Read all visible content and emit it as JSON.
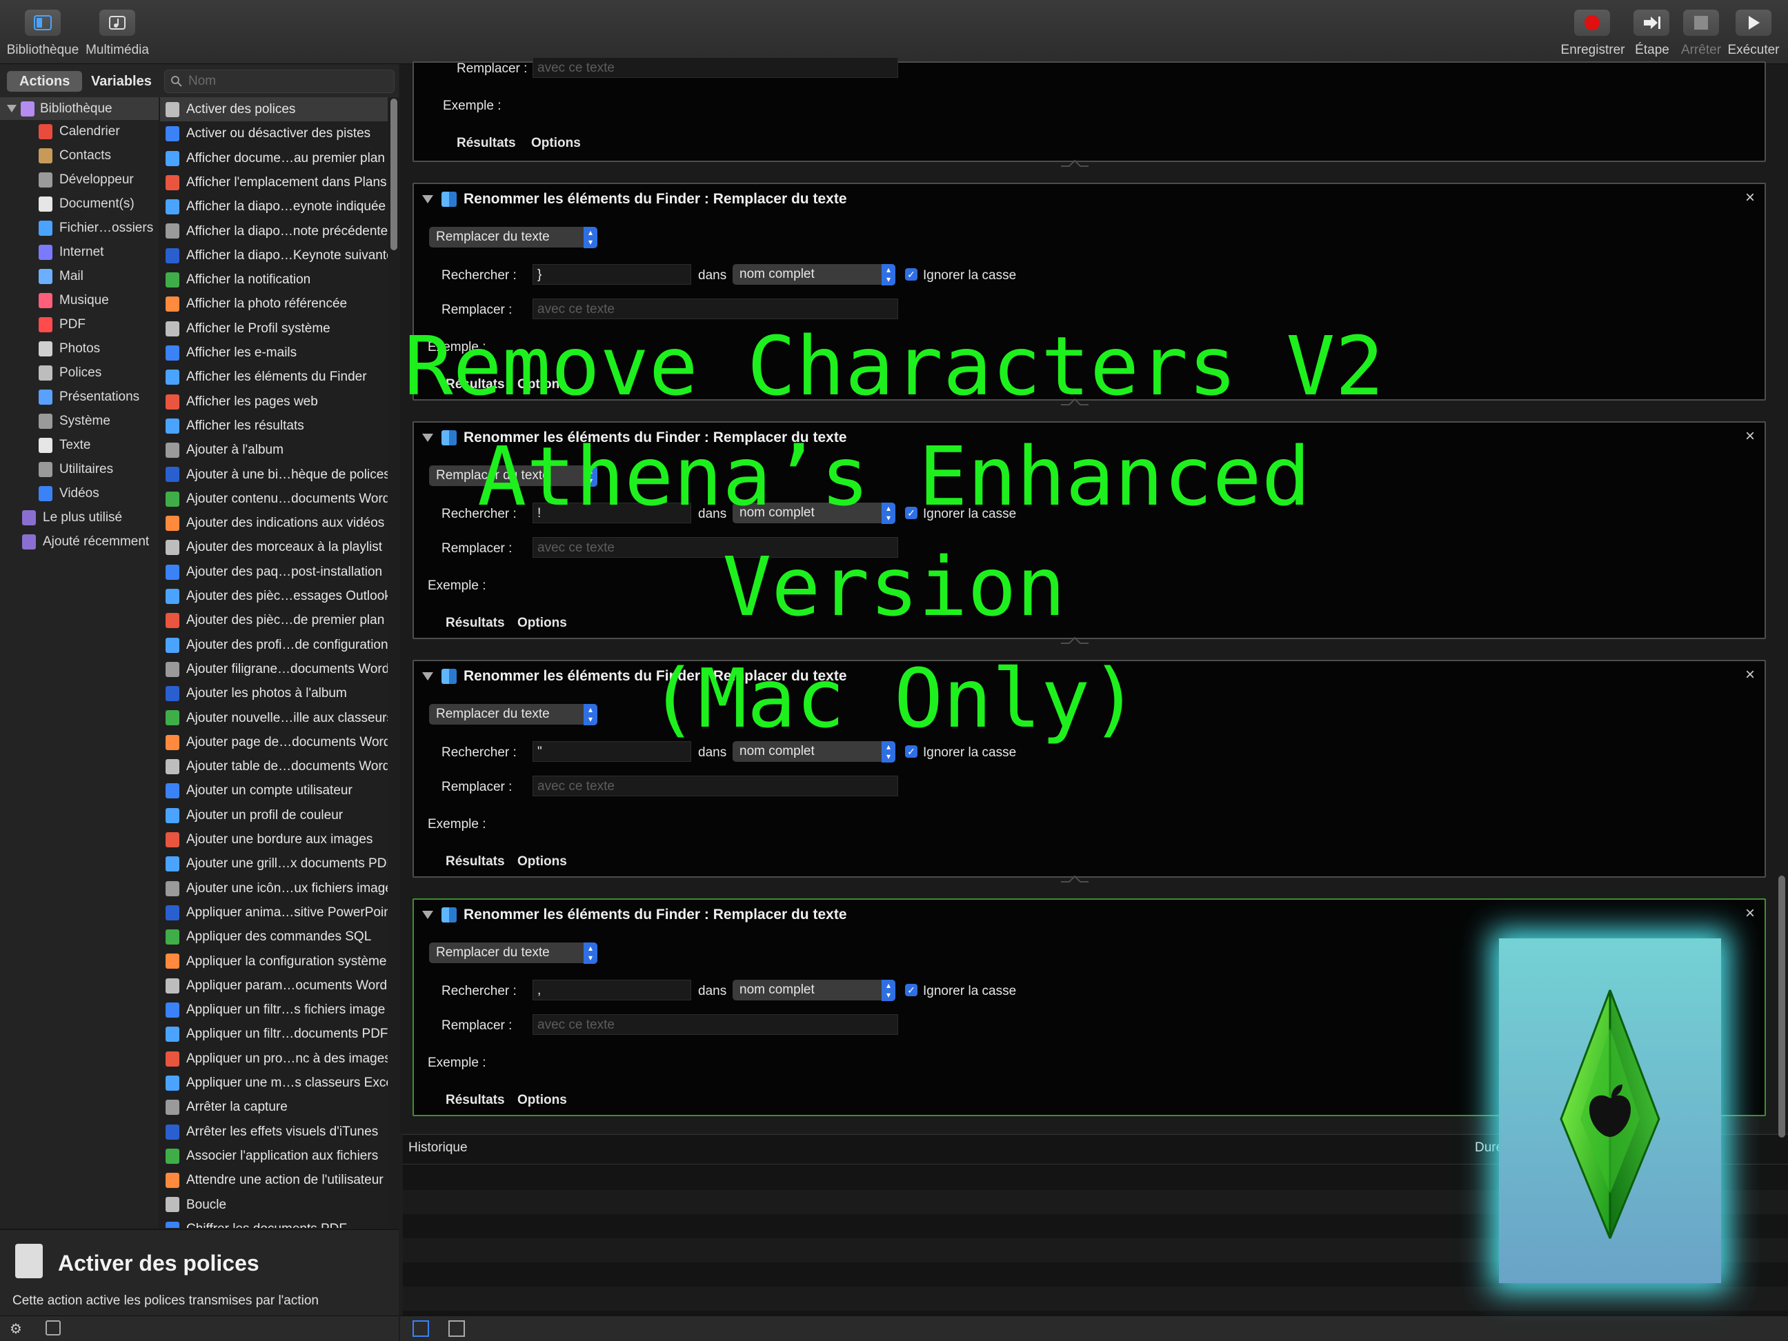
{
  "toolbar": {
    "library_label": "Bibliothèque",
    "media_label": "Multimédia",
    "record_label": "Enregistrer",
    "step_label": "Étape",
    "stop_label": "Arrêter",
    "run_label": "Exécuter"
  },
  "tabs": {
    "actions": "Actions",
    "variables": "Variables"
  },
  "search": {
    "placeholder": "Nom"
  },
  "library": {
    "root": "Bibliothèque",
    "items": [
      "Calendrier",
      "Contacts",
      "Développeur",
      "Document(s)",
      "Fichier…ossiers",
      "Internet",
      "Mail",
      "Musique",
      "PDF",
      "Photos",
      "Polices",
      "Présentations",
      "Système",
      "Texte",
      "Utilitaires",
      "Vidéos"
    ],
    "smart": [
      "Le plus utilisé",
      "Ajouté récemment"
    ]
  },
  "actions": [
    "Activer des polices",
    "Activer ou désactiver des pistes",
    "Afficher docume…au premier plan",
    "Afficher l'emplacement dans Plans",
    "Afficher la diapo…eynote indiquée",
    "Afficher la diapo…note précédente",
    "Afficher la diapo…Keynote suivante",
    "Afficher la notification",
    "Afficher la photo référencée",
    "Afficher le Profil système",
    "Afficher les e-mails",
    "Afficher les éléments du Finder",
    "Afficher les pages web",
    "Afficher les résultats",
    "Ajouter à l'album",
    "Ajouter à une bi…hèque de polices",
    "Ajouter contenu…documents Word",
    "Ajouter des indications aux vidéos",
    "Ajouter des morceaux à la playlist",
    "Ajouter des paq…post-installation",
    "Ajouter des pièc…essages Outlook",
    "Ajouter des pièc…de premier plan",
    "Ajouter des profi…de configuration",
    "Ajouter filigrane…documents Word",
    "Ajouter les photos à l'album",
    "Ajouter nouvelle…ille aux classeurs",
    "Ajouter page de…documents Word",
    "Ajouter table de…documents Word",
    "Ajouter un compte utilisateur",
    "Ajouter un profil de couleur",
    "Ajouter une bordure aux images",
    "Ajouter une grill…x documents PDF",
    "Ajouter une icôn…ux fichiers image",
    "Appliquer anima…sitive PowerPoint",
    "Appliquer des commandes SQL",
    "Appliquer la configuration système",
    "Appliquer param…ocuments Word",
    "Appliquer un filtr…s fichiers image",
    "Appliquer un filtr…documents PDF",
    "Appliquer un pro…nc à des images",
    "Appliquer une m…s classeurs Excel",
    "Arrêter la capture",
    "Arrêter les effets visuels d'iTunes",
    "Associer l'application aux fichiers",
    "Attendre une action de l'utilisateur",
    "Boucle",
    "Chiffrer les documents PDF"
  ],
  "description": {
    "title": "Activer des polices",
    "text": "Cette action active les polices transmises par l'action"
  },
  "workflow": {
    "replace_label": "Remplacer :",
    "search_label": "Rechercher :",
    "example_label": "Exemple :",
    "results_label": "Résultats",
    "options_label": "Options",
    "in_label": "dans",
    "replace_placeholder": "avec ce texte",
    "card_title": "Renommer les éléments du Finder : Remplacer du texte",
    "mode": "Remplacer du texte",
    "scope": "nom complet",
    "ignore_case": "Ignorer la casse",
    "cards": [
      {
        "search": "}"
      },
      {
        "search": "!"
      },
      {
        "search": "\""
      },
      {
        "search": ","
      }
    ]
  },
  "history": {
    "header": "Historique",
    "duration_header": "Durée"
  },
  "overlay": {
    "line1": "Remove Characters V2",
    "line2": "Athena’s Enhanced",
    "line3": "Version",
    "line4": "(Mac Only)"
  },
  "colors": {
    "overlay_text": "#1ef01e",
    "accent": "#2f6fe4",
    "record": "#e01010"
  }
}
